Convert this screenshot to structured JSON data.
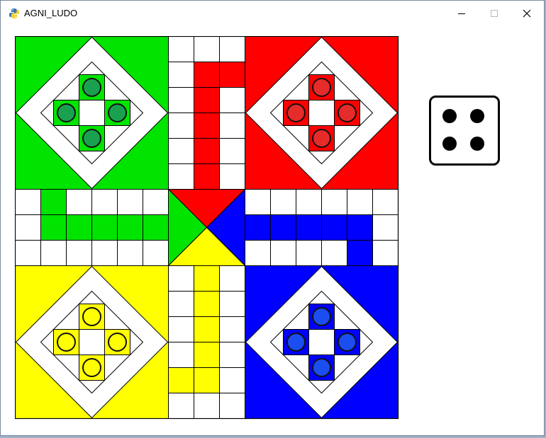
{
  "window": {
    "title": "AGNI_LUDO",
    "icon": "python-icon",
    "controls": [
      "minimize",
      "maximize",
      "close"
    ]
  },
  "colors": {
    "green": "#00e400",
    "green_token": "#1aa150",
    "red": "#ff0000",
    "red_token": "#e62b2b",
    "yellow": "#ffff00",
    "yellow_token": "#ffff00",
    "blue": "#0000ff",
    "blue_token": "#1b4ef0",
    "grid_line": "#000000",
    "cell": "#ffffff"
  },
  "board": {
    "grid_size": 15,
    "home_bases": [
      {
        "color": "green",
        "quadrant": "top-left",
        "tokens": 4
      },
      {
        "color": "red",
        "quadrant": "top-right",
        "tokens": 4
      },
      {
        "color": "yellow",
        "quadrant": "bottom-left",
        "tokens": 4
      },
      {
        "color": "blue",
        "quadrant": "bottom-right",
        "tokens": 4
      }
    ],
    "colored_path_cells": {
      "red": [
        [
          1,
          7
        ],
        [
          1,
          8
        ],
        [
          2,
          7
        ],
        [
          3,
          7
        ],
        [
          4,
          7
        ],
        [
          5,
          7
        ]
      ],
      "green": [
        [
          6,
          1
        ],
        [
          7,
          1
        ],
        [
          7,
          2
        ],
        [
          7,
          3
        ],
        [
          7,
          4
        ],
        [
          7,
          5
        ]
      ],
      "blue": [
        [
          7,
          9
        ],
        [
          7,
          10
        ],
        [
          7,
          11
        ],
        [
          7,
          12
        ],
        [
          7,
          13
        ],
        [
          8,
          13
        ]
      ],
      "yellow": [
        [
          9,
          7
        ],
        [
          10,
          7
        ],
        [
          11,
          7
        ],
        [
          12,
          7
        ],
        [
          13,
          7
        ],
        [
          13,
          6
        ]
      ]
    },
    "center_triangles": {
      "top": "red",
      "left": "green",
      "right": "blue",
      "bottom": "yellow"
    }
  },
  "dice": {
    "value": 4
  }
}
